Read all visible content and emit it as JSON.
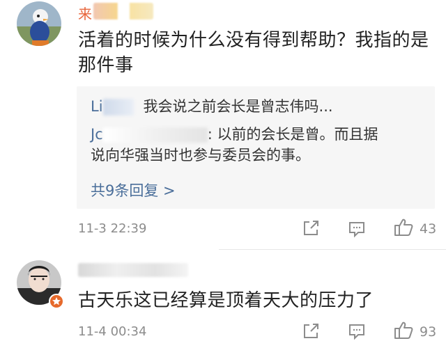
{
  "comments": [
    {
      "username_visible": "来",
      "text_line1": "活着的时候为什么没有得到帮助？我指的是",
      "text_line2": "那件事",
      "replies": [
        {
          "user_prefix": "Li",
          "separator": "",
          "text": "我会说之前会长是曾志伟吗..."
        },
        {
          "user_prefix": "Jc",
          "separator": ":",
          "text_line1": "以前的会长是曾。而且据",
          "text_line2": "说向华强当时也参与委员会的事。"
        }
      ],
      "more_replies": "共9条回复 >",
      "timestamp": "11-3 22:39",
      "likes": "43"
    },
    {
      "username_visible": "",
      "text": "古天乐这已经算是顶着天大的压力了",
      "timestamp": "11-4 00:34",
      "likes": "93"
    }
  ],
  "icons": {
    "share": "share-icon",
    "comment": "comment-icon",
    "like": "thumbs-up-icon"
  },
  "colors": {
    "link": "#4a6e9a",
    "meta": "#8c8c8c",
    "reply_bg": "#f6f6f6"
  }
}
